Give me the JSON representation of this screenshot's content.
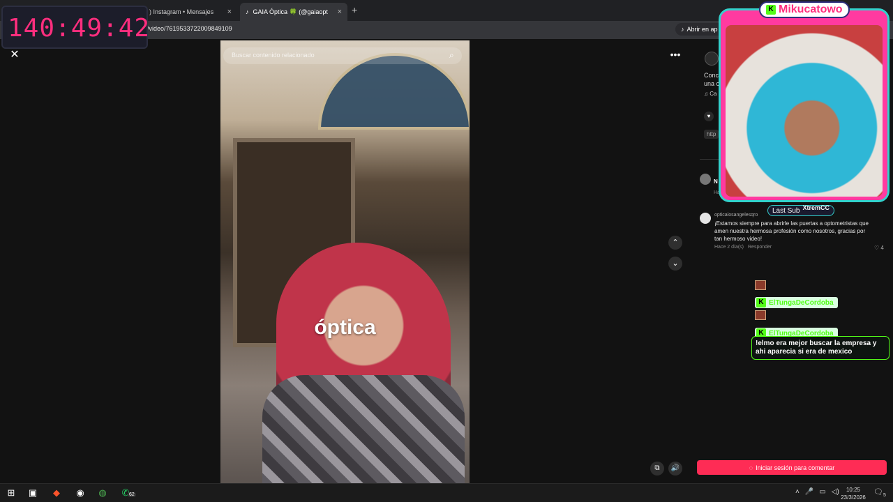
{
  "browser": {
    "tabs": [
      {
        "label": ") Instagram • Mensajes",
        "close": "×"
      },
      {
        "label": "GAIA Óptica 🍀 (@gaiaopt",
        "close": "×"
      }
    ],
    "new_tab": "+",
    "url": "ts/video/7619533722009849109",
    "open_app": "Abrir en ap"
  },
  "video": {
    "search_placeholder": "Buscar contenido relacionado",
    "caption": "óptica",
    "close_glyph": "✕",
    "more_glyph": "•••",
    "up_glyph": "⌃",
    "down_glyph": "⌄"
  },
  "panel": {
    "desc_line1": "Conc",
    "desc_line2": "una c",
    "music": "♫  Ca",
    "link": "http",
    "comment1": {
      "name": "N",
      "meta": "Ha"
    },
    "comment2": {
      "user": "opticalosangelesqro",
      "text": "¡Estamos siempre para abrirle las puertas a optometristas que amen nuestra hermosa profesión como nosotros, gracias por tan hermoso video!",
      "time": "Hace 2 día(s)",
      "reply": "Responder",
      "likes": "♡ 4"
    },
    "login_button": "Iniciar sesión para comentar"
  },
  "overlay": {
    "timer": "140:49:42",
    "logo": "Mikucatowo",
    "last_sub_label": "Last Sub",
    "last_sub_name": "XtremCC",
    "chat": [
      {
        "name": "ElTungaDeCordoba"
      },
      {
        "name": "ElTungaDeCordoba",
        "message": "!elmo era mejor buscar la empresa y ahi aparecia si era de mexico"
      }
    ]
  },
  "taskbar": {
    "whatsapp_badge": "62",
    "clock_time": "10:25",
    "clock_date": "23/3/2026",
    "notifications": "5"
  },
  "colors": {
    "accent_pink": "#fe2c55",
    "timer_pink": "#ff2e7e",
    "kick_green": "#53fc18",
    "frame_cyan": "#33d1cc"
  }
}
